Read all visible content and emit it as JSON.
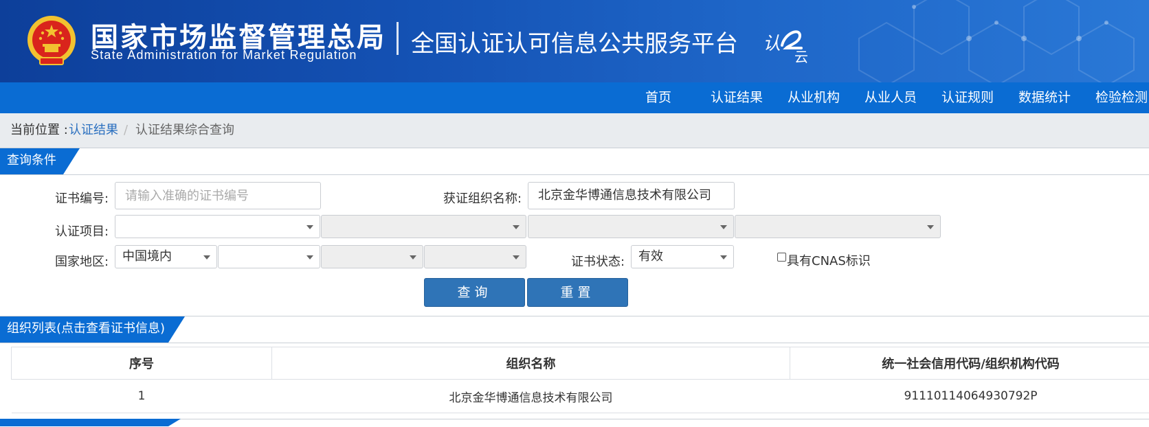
{
  "header": {
    "agency_cn": "国家市场监督管理总局",
    "agency_en": "State Administration  for  Market Regulation",
    "platform_title": "全国认证认可信息公共服务平台",
    "logo_chars": [
      "认",
      "云"
    ]
  },
  "nav": {
    "items": [
      "首页",
      "认证结果",
      "从业机构",
      "从业人员",
      "认证规则",
      "数据统计",
      "检验检测"
    ]
  },
  "breadcrumb": {
    "prefix": "当前位置 :",
    "link": "认证结果",
    "separator": "/",
    "current": "认证结果综合查询"
  },
  "query_section": {
    "title": "查询条件",
    "cert_number_label": "证书编号:",
    "cert_number_placeholder": "请输入准确的证书编号",
    "cert_number_value": "",
    "org_name_label": "获证组织名称:",
    "org_name_value": "北京金华博通信息技术有限公司",
    "cert_project_label": "认证项目:",
    "cert_project_selects": [
      "",
      "",
      "",
      ""
    ],
    "region_label": "国家地区:",
    "region_selects": [
      "中国境内",
      "",
      "",
      ""
    ],
    "cert_status_label": "证书状态:",
    "cert_status_value": "有效",
    "cnas_label": "具有CNAS标识",
    "cnas_checked": false,
    "search_button": "查询",
    "reset_button": "重置"
  },
  "org_list_section": {
    "title": "组织列表(点击查看证书信息)",
    "columns": [
      "序号",
      "组织名称",
      "统一社会信用代码/组织机构代码"
    ],
    "rows": [
      [
        "1",
        "北京金华博通信息技术有限公司",
        "91110114064930792P"
      ]
    ]
  },
  "colors": {
    "header_bg": "#1451b3",
    "nav_bg": "#0a6cd3",
    "button_bg": "#2f74b7",
    "link": "#2a6fbf"
  }
}
